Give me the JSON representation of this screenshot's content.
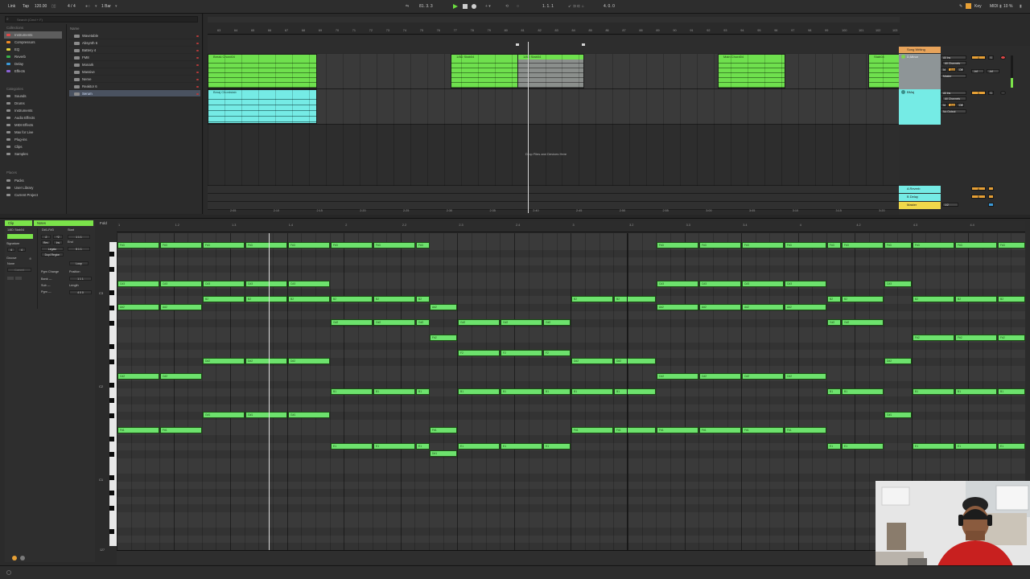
{
  "transport": {
    "link": "Link",
    "tap": "Tap",
    "tempo": "120.00",
    "time_sig": "4 / 4",
    "quantize": "1 Bar",
    "position": "81. 3. 3",
    "loop_start": "1. 1. 1",
    "loop_length": "4. 0. 0",
    "key": "Key",
    "midi": "MIDI",
    "cpu": "10 %"
  },
  "browser": {
    "search_placeholder": "Search (Cmd + F)",
    "collections_label": "Collections",
    "collections": [
      {
        "label": "Instruments",
        "color": "#e14848",
        "selected": true
      },
      {
        "label": "Compressors",
        "color": "#ef8a26"
      },
      {
        "label": "EQ",
        "color": "#e6d43a"
      },
      {
        "label": "Reverb",
        "color": "#38b04a"
      },
      {
        "label": "Delay",
        "color": "#3b9ad8"
      },
      {
        "label": "Effects",
        "color": "#8a62d6"
      }
    ],
    "categories_label": "Categories",
    "categories": [
      "Sounds",
      "Drums",
      "Instruments",
      "Audio Effects",
      "MIDI Effects",
      "Max for Live",
      "Plug-ins",
      "Clips",
      "Samples"
    ],
    "places_label": "Places",
    "places": [
      "Packs",
      "User Library",
      "Current Project"
    ],
    "name_header": "Name",
    "files": [
      "Wavetable",
      "Absynth 6",
      "Battery 4",
      "FM8",
      "Monark",
      "Massive",
      "Nerve",
      "Reaktor 6",
      "Serum"
    ]
  },
  "arrangement": {
    "ruler_ticks": [
      "63",
      "64",
      "65",
      "66",
      "67",
      "68",
      "69",
      "70",
      "71",
      "72",
      "73",
      "74",
      "75",
      "76",
      "77",
      "78",
      "79",
      "80",
      "81",
      "82",
      "83",
      "84",
      "85",
      "86",
      "87",
      "88",
      "89",
      "90",
      "91",
      "92",
      "93",
      "94",
      "95",
      "96",
      "97",
      "98",
      "99",
      "100",
      "101",
      "102",
      "103"
    ],
    "time_ticks": [
      "2:05",
      "2:10",
      "2:15",
      "2:20",
      "2:25",
      "2:30",
      "2:35",
      "2:40",
      "2:45",
      "2:50",
      "2:55",
      "3:00",
      "3:05",
      "3:10",
      "3:15",
      "3:20"
    ],
    "clips_track1": [
      "Break Chord04",
      "1/8D Stab04",
      "1/8D Stab04",
      "Main Chord04",
      "Stab04"
    ],
    "clips_track2": [
      "Bmaj Chordstab"
    ],
    "drop_text": "Drop Files and Devices Here",
    "tracks": [
      {
        "name": "Song Writing",
        "color": "#e7a35a"
      },
      {
        "name": "D,Minor",
        "color": "#8bd64c",
        "input": "All Ins",
        "channel": "All Channels",
        "monitor_in": "In",
        "monitor_auto": "Auto",
        "monitor_off": "Off",
        "output": "Master",
        "level": "4"
      },
      {
        "name": "BMaj",
        "color": "#6ee8e3",
        "input": "All Ins",
        "channel": "All Channels",
        "monitor_in": "In",
        "monitor_auto": "Auto",
        "monitor_off": "Off",
        "output": "No Output",
        "level": "5"
      }
    ],
    "returns": [
      {
        "name": "A Reverb",
        "color": "#6ee8e3",
        "letter": "A"
      },
      {
        "name": "B Delay",
        "color": "#6ee8e3",
        "letter": "B"
      },
      {
        "name": "Master",
        "color": "#f0d84a",
        "fraction": "1/2"
      }
    ]
  },
  "clip_panel": {
    "clip_tab": "Clip",
    "notes_tab": "Notes",
    "clip_name": "1/8D Stab04",
    "range": "D#1-F#3",
    "start_label": "Start",
    "start_value": "1  1  1",
    "end_label": "End",
    "end_value": "5  1  1",
    "signature_label": "Signature",
    "sig_num": "4",
    "sig_den": "4",
    "groove_label": "Groove",
    "groove_value": "None",
    "commit": "Commit",
    "fold_label": "Fold",
    "scale_btns": [
      ":2",
      "*2",
      "Rev",
      "Inv",
      "Legato",
      "Dupl.Region"
    ],
    "loop_label": "Loop",
    "pgm_change": "Pgm Change",
    "position_label": "Position",
    "position_value": "1  1  1",
    "bank": "Bank ---",
    "sub": "Sub ---",
    "pgm": "Pgm ---",
    "length_label": "Length",
    "length_value": "4  0  0"
  },
  "piano_roll": {
    "fold": "Fold",
    "bar_ticks": [
      "1",
      "1.2",
      "1.3",
      "1.4",
      "2",
      "2.2",
      "2.3",
      "2.4",
      "3",
      "3.2",
      "3.3",
      "3.4",
      "4",
      "4.2",
      "4.3",
      "4.4"
    ],
    "key_labels": [
      "C3",
      "C2",
      "C1"
    ],
    "velocity_label": "127"
  },
  "status": {
    "text": ""
  }
}
